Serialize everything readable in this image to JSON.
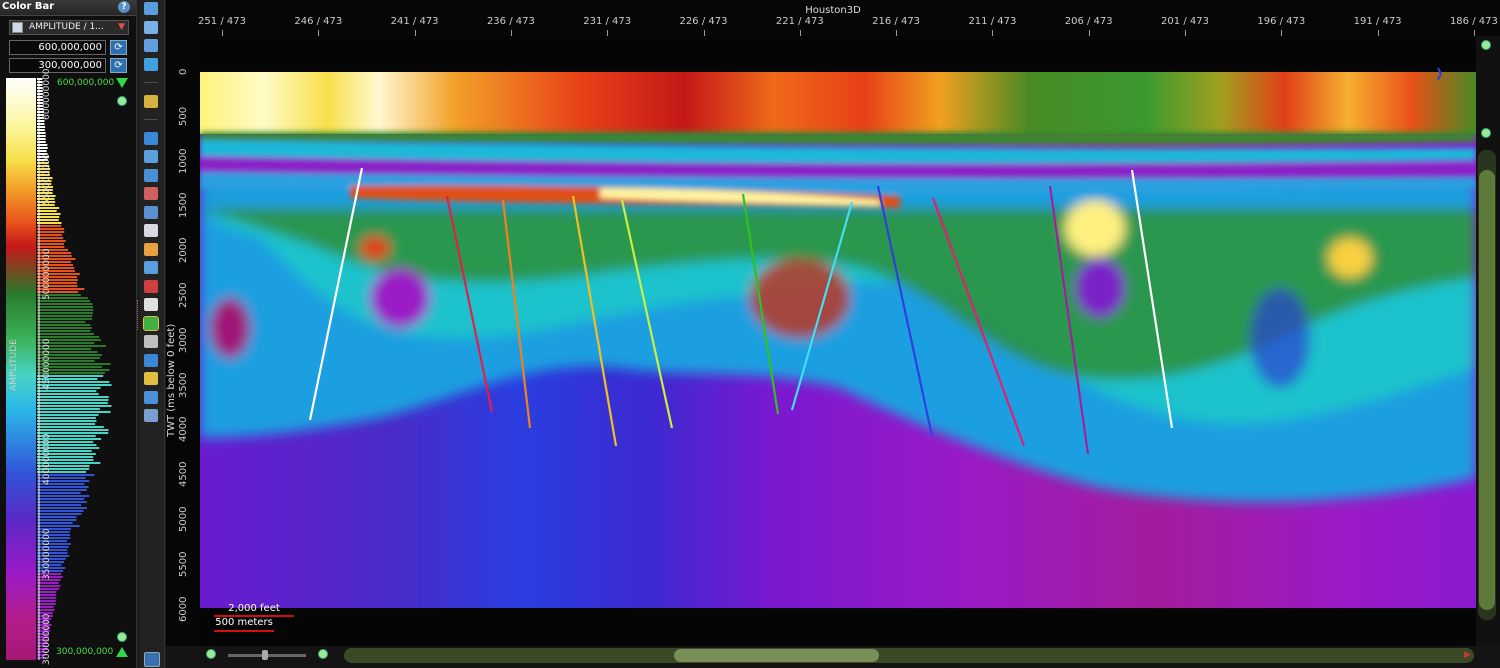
{
  "colorbar": {
    "title": "Color Bar",
    "attribute": "AMPLITUDE / 1...",
    "max_value": "600,000,000",
    "min_value": "300,000,000",
    "max_label": "600,000,000",
    "min_label": "300,000,000",
    "vertical_label": "AMPLITUDE",
    "ticks": [
      "600000000",
      "550000000",
      "500000000",
      "450000000",
      "400000000",
      "350000000",
      "300000000"
    ]
  },
  "viewer": {
    "title": "Houston3D",
    "inline_labels": [
      "251 / 473",
      "246 / 473",
      "241 / 473",
      "236 / 473",
      "231 / 473",
      "226 / 473",
      "221 / 473",
      "216 / 473",
      "211 / 473",
      "206 / 473",
      "201 / 473",
      "196 / 473",
      "191 / 473",
      "186 / 473"
    ],
    "y_axis_title": "TWT (ms below 0 feet)",
    "y_ticks": [
      "0",
      "500",
      "1000",
      "1500",
      "2000",
      "2500",
      "3000",
      "3500",
      "4000",
      "4500",
      "5000",
      "5500",
      "6000"
    ],
    "scalebar_feet": "2,000 feet",
    "scalebar_meters": "500 meters"
  },
  "faults": [
    {
      "color": "#ffffff"
    },
    {
      "color": "#e0204a"
    },
    {
      "color": "#f08020"
    },
    {
      "color": "#f0c020"
    },
    {
      "color": "#c8f040"
    },
    {
      "color": "#30c020"
    },
    {
      "color": "#40e0f0"
    },
    {
      "color": "#3040e0"
    },
    {
      "color": "#e02070"
    },
    {
      "color": "#a020a0"
    },
    {
      "color": "#ffffff"
    }
  ],
  "icons": {
    "help": "help-icon",
    "refresh": "refresh-icon",
    "zoom_in": "zoom-in-icon",
    "zoom_out": "zoom-out-icon"
  }
}
